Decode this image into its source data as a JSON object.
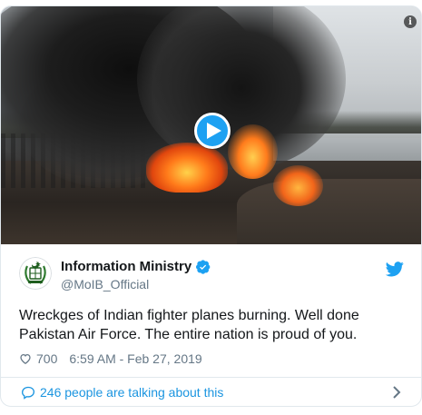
{
  "media": {
    "play_icon": "play-icon",
    "info_icon": "info-icon",
    "info_glyph": "i"
  },
  "author": {
    "name": "Information Ministry",
    "handle": "@MoIB_Official",
    "verified": true,
    "avatar": "pakistan-emblem-avatar"
  },
  "tweet": {
    "text": "Wreckges of Indian fighter planes burning. Well done Pakistan Air Force. The entire nation is proud of you.",
    "likes": "700",
    "timestamp": "6:59 AM - Feb 27, 2019"
  },
  "footer": {
    "talking_label": "246 people are talking about this"
  },
  "colors": {
    "brand_blue": "#1da1f2",
    "link_blue": "#1b95e0",
    "muted_text": "#657786",
    "border": "#e1e8ed"
  }
}
